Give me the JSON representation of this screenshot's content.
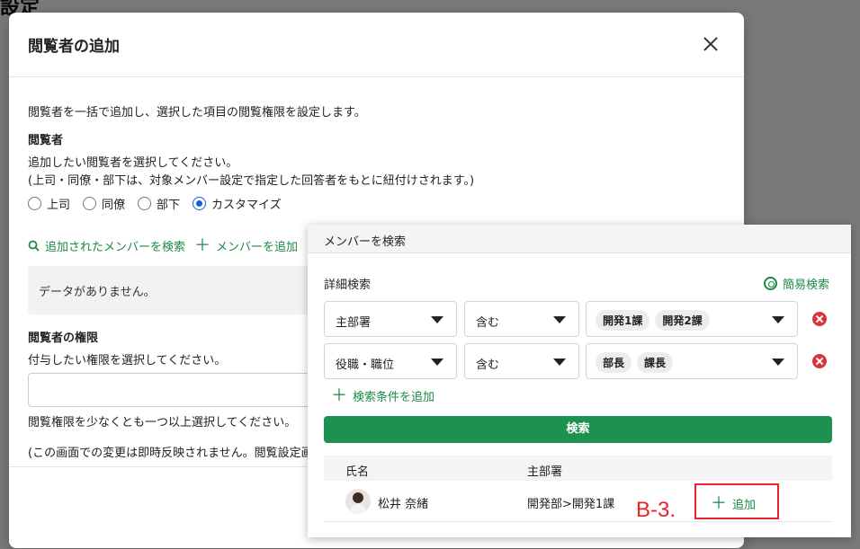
{
  "background": {
    "page_title": "設定"
  },
  "dialog": {
    "title": "閲覧者の追加",
    "description": "閲覧者を一括で追加し、選択した項目の閲覧権限を設定します。",
    "viewers_heading": "閲覧者",
    "viewers_instruction": "追加したい閲覧者を選択してください。",
    "viewers_note": "(上司・同僚・部下は、対象メンバー設定で指定した回答者をもとに紐付けされます。)",
    "radio_options": [
      {
        "label": "上司",
        "checked": false
      },
      {
        "label": "同僚",
        "checked": false
      },
      {
        "label": "部下",
        "checked": false
      },
      {
        "label": "カスタマイズ",
        "checked": true
      }
    ],
    "search_added_link": "追加されたメンバーを検索",
    "add_member_link": "メンバーを追加",
    "no_data": "データがありません。",
    "permission_heading": "閲覧者の権限",
    "permission_instruction": "付与したい権限を選択してください。",
    "permission_warning": "閲覧権限を少なくとも一つ以上選択してください。",
    "note_truncated": "(この画面での変更は即時反映されません。閲覧設定画"
  },
  "popover": {
    "title": "メンバーを検索",
    "section_label": "詳細検索",
    "simple_search": "簡易検索",
    "conditions": [
      {
        "field": "主部署",
        "operator": "含む",
        "values": [
          "開発1課",
          "開発2課"
        ]
      },
      {
        "field": "役職・職位",
        "operator": "含む",
        "values": [
          "部長",
          "課長"
        ]
      }
    ],
    "add_condition": "検索条件を追加",
    "search_button": "検索",
    "table": {
      "columns": [
        "氏名",
        "主部署"
      ],
      "rows": [
        {
          "name": "松井 奈緒",
          "department": "開発部>開発1課",
          "action": "追加"
        }
      ]
    }
  },
  "annotation": {
    "label": "B-3."
  },
  "colors": {
    "accent_green": "#1d9150",
    "link_green": "#1a8a45",
    "danger_red": "#d9343a",
    "annotation_red": "#e8232a",
    "radio_blue": "#1a5fd6"
  }
}
